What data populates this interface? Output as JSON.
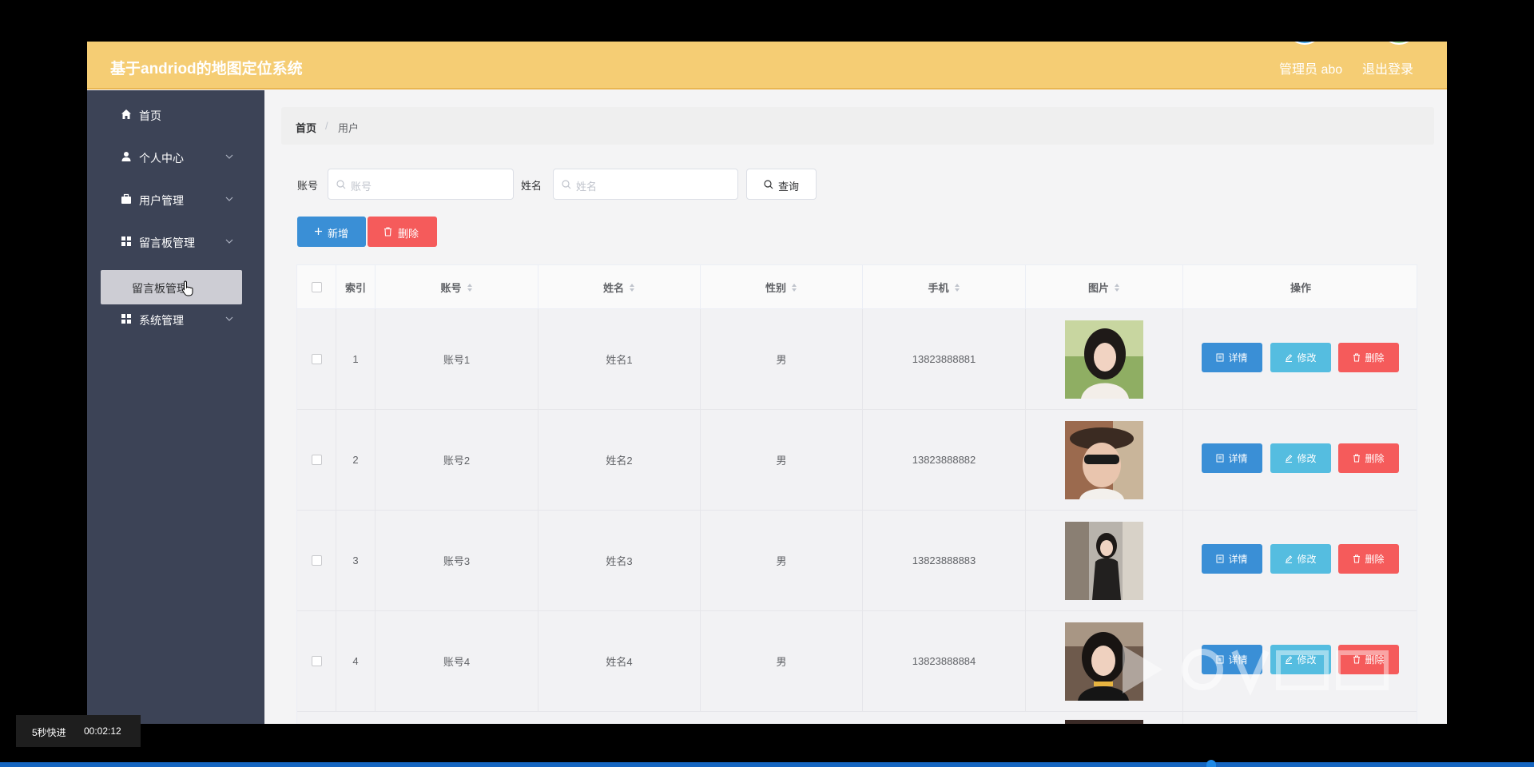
{
  "header": {
    "title": "基于andriod的地图定位系统",
    "admin_label": "管理员 abo",
    "logout_label": "退出登录"
  },
  "sidebar": {
    "items": [
      {
        "label": "首页",
        "icon": "home-icon"
      },
      {
        "label": "个人中心",
        "icon": "user-icon"
      },
      {
        "label": "用户管理",
        "icon": "briefcase-icon"
      },
      {
        "label": "留言板管理",
        "icon": "grid-icon"
      },
      {
        "label": "系统管理",
        "icon": "grid-icon"
      }
    ],
    "active_sub_item": "留言板管理"
  },
  "breadcrumb": {
    "home": "首页",
    "separator": "/",
    "current": "用户"
  },
  "search": {
    "account_label": "账号",
    "account_placeholder": "账号",
    "name_label": "姓名",
    "name_placeholder": "姓名",
    "query_button": "查询"
  },
  "toolbar": {
    "add_label": "新增",
    "delete_label": "删除"
  },
  "table": {
    "headers": {
      "index": "索引",
      "account": "账号",
      "name": "姓名",
      "gender": "性别",
      "phone": "手机",
      "image": "图片",
      "actions": "操作"
    },
    "rows": [
      {
        "index": "1",
        "account": "账号1",
        "name": "姓名1",
        "gender": "男",
        "phone": "13823888881"
      },
      {
        "index": "2",
        "account": "账号2",
        "name": "姓名2",
        "gender": "男",
        "phone": "13823888882"
      },
      {
        "index": "3",
        "account": "账号3",
        "name": "姓名3",
        "gender": "男",
        "phone": "13823888883"
      },
      {
        "index": "4",
        "account": "账号4",
        "name": "姓名4",
        "gender": "男",
        "phone": "13823888884"
      }
    ],
    "row_actions": {
      "detail": "详情",
      "edit": "修改",
      "delete": "删除"
    }
  },
  "player": {
    "fast_forward": "5秒快进",
    "time": "00:02:12"
  },
  "colors": {
    "header_bg": "#f5cd74",
    "sidebar_bg": "#3c4356",
    "primary": "#3a8fd6",
    "info": "#55bde0",
    "danger": "#f55b5b"
  }
}
